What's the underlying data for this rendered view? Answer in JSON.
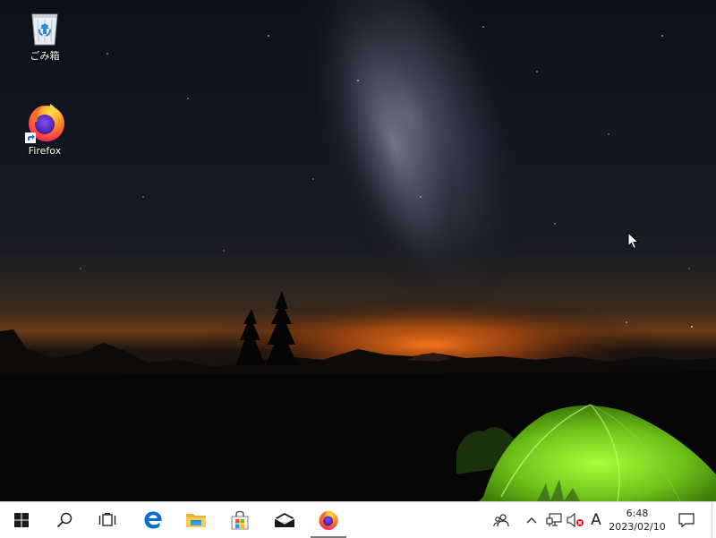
{
  "desktop": {
    "icons": [
      {
        "label": "ごみ箱",
        "icon": "recycle-bin-icon"
      },
      {
        "label": "Firefox",
        "icon": "firefox-icon"
      }
    ]
  },
  "taskbar": {
    "apps": [
      {
        "icon": "windows-start-icon"
      },
      {
        "icon": "search-icon"
      },
      {
        "icon": "task-view-icon"
      },
      {
        "icon": "edge-icon"
      },
      {
        "icon": "file-explorer-icon"
      },
      {
        "icon": "store-icon"
      },
      {
        "icon": "mail-icon"
      },
      {
        "icon": "firefox-icon"
      }
    ],
    "tray": {
      "ime": "A",
      "time": "6:48",
      "date": "2023/02/10"
    }
  },
  "colors": {
    "taskbar_bg": "#ffffff",
    "edge_blue": "#0a6ecf",
    "windows_blue": "#1f5fb8",
    "tent_green": "#7ed321"
  }
}
